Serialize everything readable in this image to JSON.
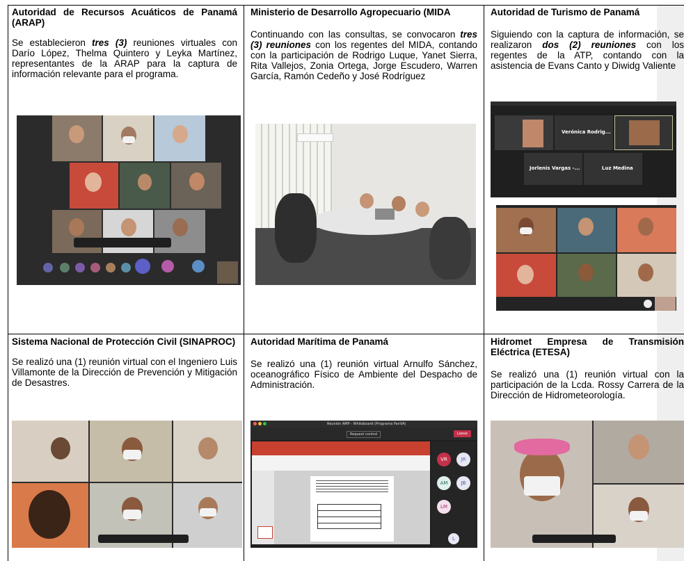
{
  "cells": [
    {
      "title": "Autoridad de Recursos Acuáticos de Panamá (ARAP)",
      "text_before": "Se establecieron ",
      "emphasis": "tres (3)",
      "text_after": " reuniones virtuales con Darío López, Thelma Quintero y Leyka Martínez, representantes de la ARAP para la captura de información relevante para el programa."
    },
    {
      "title": "Ministerio de Desarrollo Agropecuario (MIDA",
      "text_before": "Continuando con las consultas, se convocaron ",
      "emphasis": "tres (3) reuniones",
      "text_after": " con los regentes del MIDA, contando con la participación de Rodrigo Luque, Yanet Sierra, Rita Vallejos, Zonia Ortega, Jorge Escudero, Warren García, Ramón Cedeño y José Rodríguez"
    },
    {
      "title": "Autoridad de Turismo de Panamá",
      "text_before": "Siguiendo con la captura de información, se realizaron ",
      "emphasis": "dos (2) reuniones",
      "text_after": " con los regentes de la ATP, contando con la asistencia de Evans Canto y Diwidg Valiente"
    },
    {
      "title": "Sistema Nacional de Protección Civil (SINAPROC)",
      "text_before": "Se realizó una (1) reunión virtual con el Ingeniero Luis Villamonte de la Dirección de Prevención y Mitigación de Desastres.",
      "emphasis": "",
      "text_after": ""
    },
    {
      "title": "Autoridad Marítima de Panamá",
      "text_before": "Se realizó una (1) reunión virtual Arnulfo Sánchez, oceanográfico Físico de Ambiente del Despacho de Administración.",
      "emphasis": "",
      "text_after": ""
    },
    {
      "title": "Hidromet Empresa de Transmisión Eléctrica (ETESA)",
      "text_before": "Se realizó una (1) reunión virtual con la participación de la Lcda. Rossy Carrera de la Dirección de Hidrometeorología.",
      "emphasis": "",
      "text_after": ""
    }
  ],
  "screens": {
    "atp_tile1": "Verónica Rodrig...",
    "atp_tile2": "Jorlenis Vargas -...",
    "atp_tile3": "Luz Medina",
    "ama_window_title": "Reunión AMP - Whiteboard (Programa PanVA)",
    "ama_request_control": "Request control",
    "ama_leave": "Leave",
    "ama_avatars": [
      "VR",
      "JR",
      "AM",
      "JB",
      "LM"
    ],
    "ama_bottom_avatar": "L"
  },
  "colors": {
    "teams_dark": "#2b2b2b",
    "ppt_red": "#c8402f",
    "leave_red": "#c4314b"
  }
}
